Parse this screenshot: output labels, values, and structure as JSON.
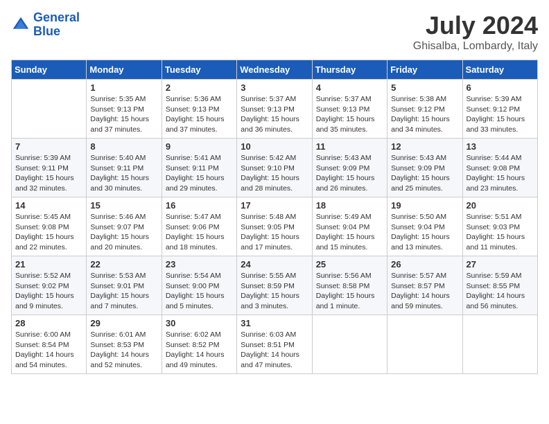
{
  "header": {
    "logo_line1": "General",
    "logo_line2": "Blue",
    "month": "July 2024",
    "location": "Ghisalba, Lombardy, Italy"
  },
  "weekdays": [
    "Sunday",
    "Monday",
    "Tuesday",
    "Wednesday",
    "Thursday",
    "Friday",
    "Saturday"
  ],
  "weeks": [
    [
      {
        "day": "",
        "info": ""
      },
      {
        "day": "1",
        "info": "Sunrise: 5:35 AM\nSunset: 9:13 PM\nDaylight: 15 hours\nand 37 minutes."
      },
      {
        "day": "2",
        "info": "Sunrise: 5:36 AM\nSunset: 9:13 PM\nDaylight: 15 hours\nand 37 minutes."
      },
      {
        "day": "3",
        "info": "Sunrise: 5:37 AM\nSunset: 9:13 PM\nDaylight: 15 hours\nand 36 minutes."
      },
      {
        "day": "4",
        "info": "Sunrise: 5:37 AM\nSunset: 9:13 PM\nDaylight: 15 hours\nand 35 minutes."
      },
      {
        "day": "5",
        "info": "Sunrise: 5:38 AM\nSunset: 9:12 PM\nDaylight: 15 hours\nand 34 minutes."
      },
      {
        "day": "6",
        "info": "Sunrise: 5:39 AM\nSunset: 9:12 PM\nDaylight: 15 hours\nand 33 minutes."
      }
    ],
    [
      {
        "day": "7",
        "info": "Sunrise: 5:39 AM\nSunset: 9:11 PM\nDaylight: 15 hours\nand 32 minutes."
      },
      {
        "day": "8",
        "info": "Sunrise: 5:40 AM\nSunset: 9:11 PM\nDaylight: 15 hours\nand 30 minutes."
      },
      {
        "day": "9",
        "info": "Sunrise: 5:41 AM\nSunset: 9:11 PM\nDaylight: 15 hours\nand 29 minutes."
      },
      {
        "day": "10",
        "info": "Sunrise: 5:42 AM\nSunset: 9:10 PM\nDaylight: 15 hours\nand 28 minutes."
      },
      {
        "day": "11",
        "info": "Sunrise: 5:43 AM\nSunset: 9:09 PM\nDaylight: 15 hours\nand 26 minutes."
      },
      {
        "day": "12",
        "info": "Sunrise: 5:43 AM\nSunset: 9:09 PM\nDaylight: 15 hours\nand 25 minutes."
      },
      {
        "day": "13",
        "info": "Sunrise: 5:44 AM\nSunset: 9:08 PM\nDaylight: 15 hours\nand 23 minutes."
      }
    ],
    [
      {
        "day": "14",
        "info": "Sunrise: 5:45 AM\nSunset: 9:08 PM\nDaylight: 15 hours\nand 22 minutes."
      },
      {
        "day": "15",
        "info": "Sunrise: 5:46 AM\nSunset: 9:07 PM\nDaylight: 15 hours\nand 20 minutes."
      },
      {
        "day": "16",
        "info": "Sunrise: 5:47 AM\nSunset: 9:06 PM\nDaylight: 15 hours\nand 18 minutes."
      },
      {
        "day": "17",
        "info": "Sunrise: 5:48 AM\nSunset: 9:05 PM\nDaylight: 15 hours\nand 17 minutes."
      },
      {
        "day": "18",
        "info": "Sunrise: 5:49 AM\nSunset: 9:04 PM\nDaylight: 15 hours\nand 15 minutes."
      },
      {
        "day": "19",
        "info": "Sunrise: 5:50 AM\nSunset: 9:04 PM\nDaylight: 15 hours\nand 13 minutes."
      },
      {
        "day": "20",
        "info": "Sunrise: 5:51 AM\nSunset: 9:03 PM\nDaylight: 15 hours\nand 11 minutes."
      }
    ],
    [
      {
        "day": "21",
        "info": "Sunrise: 5:52 AM\nSunset: 9:02 PM\nDaylight: 15 hours\nand 9 minutes."
      },
      {
        "day": "22",
        "info": "Sunrise: 5:53 AM\nSunset: 9:01 PM\nDaylight: 15 hours\nand 7 minutes."
      },
      {
        "day": "23",
        "info": "Sunrise: 5:54 AM\nSunset: 9:00 PM\nDaylight: 15 hours\nand 5 minutes."
      },
      {
        "day": "24",
        "info": "Sunrise: 5:55 AM\nSunset: 8:59 PM\nDaylight: 15 hours\nand 3 minutes."
      },
      {
        "day": "25",
        "info": "Sunrise: 5:56 AM\nSunset: 8:58 PM\nDaylight: 15 hours\nand 1 minute."
      },
      {
        "day": "26",
        "info": "Sunrise: 5:57 AM\nSunset: 8:57 PM\nDaylight: 14 hours\nand 59 minutes."
      },
      {
        "day": "27",
        "info": "Sunrise: 5:59 AM\nSunset: 8:55 PM\nDaylight: 14 hours\nand 56 minutes."
      }
    ],
    [
      {
        "day": "28",
        "info": "Sunrise: 6:00 AM\nSunset: 8:54 PM\nDaylight: 14 hours\nand 54 minutes."
      },
      {
        "day": "29",
        "info": "Sunrise: 6:01 AM\nSunset: 8:53 PM\nDaylight: 14 hours\nand 52 minutes."
      },
      {
        "day": "30",
        "info": "Sunrise: 6:02 AM\nSunset: 8:52 PM\nDaylight: 14 hours\nand 49 minutes."
      },
      {
        "day": "31",
        "info": "Sunrise: 6:03 AM\nSunset: 8:51 PM\nDaylight: 14 hours\nand 47 minutes."
      },
      {
        "day": "",
        "info": ""
      },
      {
        "day": "",
        "info": ""
      },
      {
        "day": "",
        "info": ""
      }
    ]
  ]
}
